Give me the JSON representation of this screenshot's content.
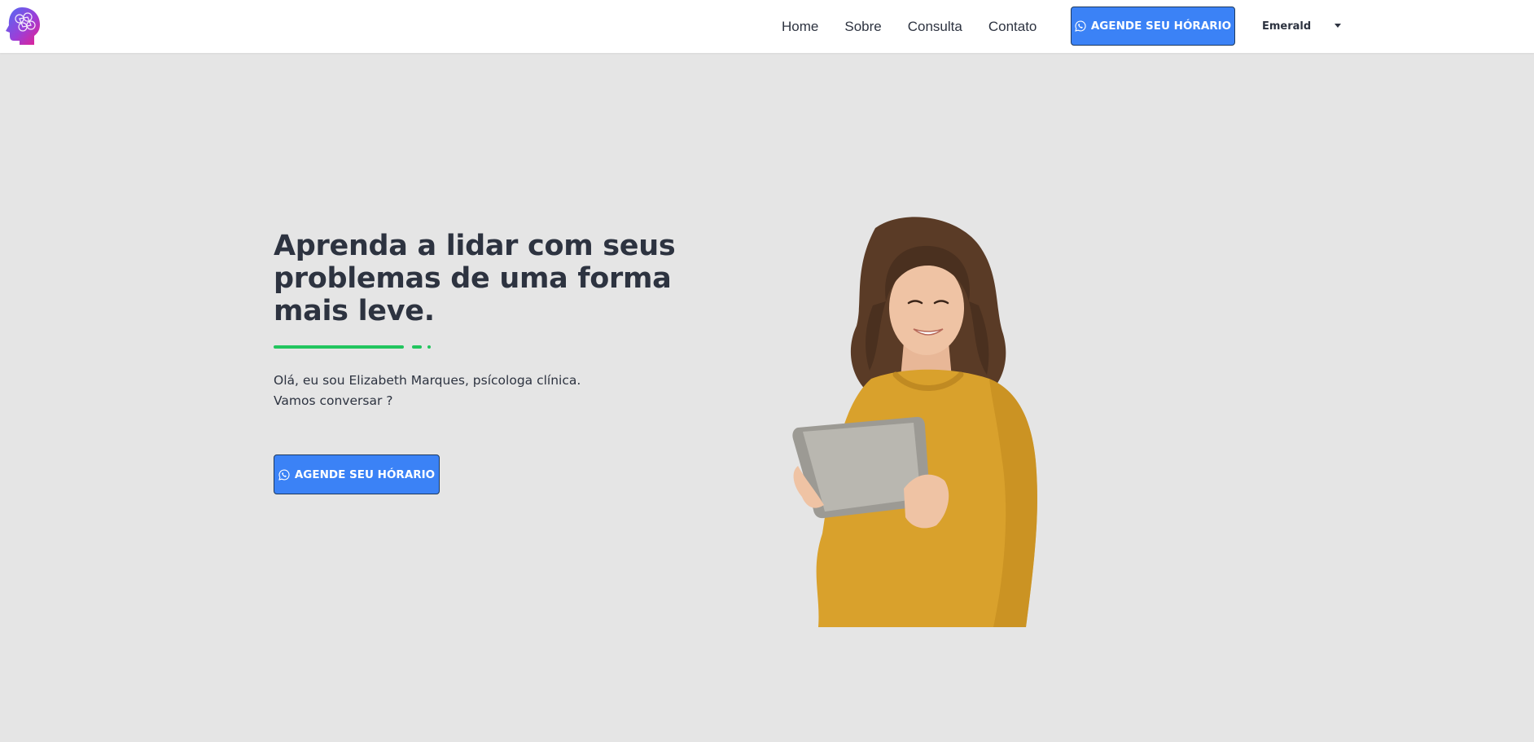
{
  "nav": {
    "links": [
      "Home",
      "Sobre",
      "Consulta",
      "Contato"
    ],
    "cta_label": "AGENDE SEU HÓRARIO",
    "theme_selected": "Emerald"
  },
  "hero": {
    "title": "Aprenda a lidar com seus problemas de uma forma mais leve.",
    "text_line1": "Olá, eu sou Elizabeth Marques, psícologa clínica.",
    "text_line2": "Vamos conversar ?",
    "cta_label": "AGENDE SEU HÓRARIO"
  },
  "icons": {
    "logo": "head-brain-logo",
    "cta": "whatsapp-icon",
    "dropdown": "caret-down-icon"
  },
  "colors": {
    "primary": "#3b82f6",
    "accent": "#22c55e",
    "text": "#2d3340",
    "background": "#e5e5e5",
    "navbar": "#ffffff",
    "sweater": "#d9a12c"
  }
}
